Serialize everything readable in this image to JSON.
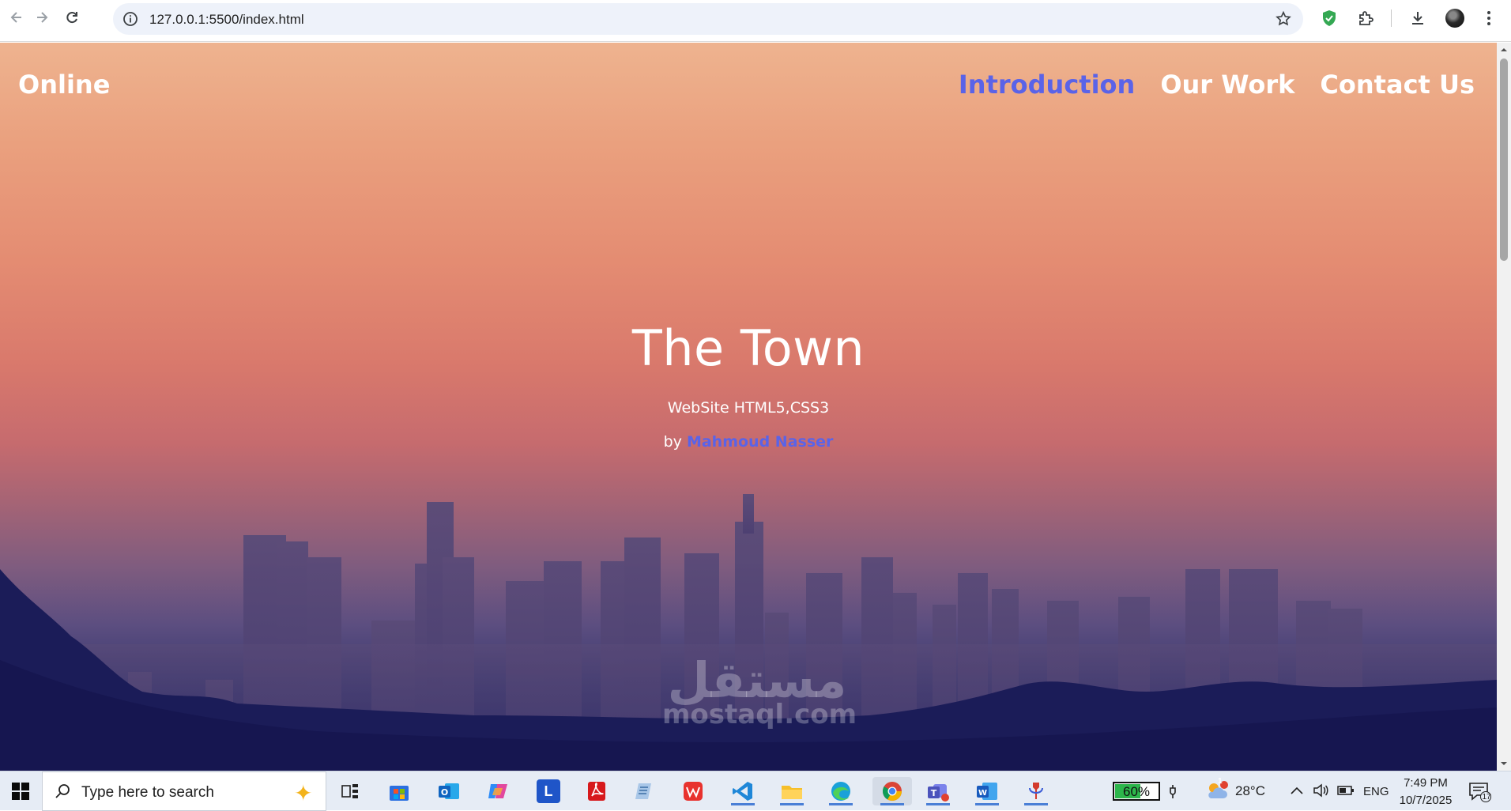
{
  "browser": {
    "url": "127.0.0.1:5500/index.html"
  },
  "site": {
    "logo": "Online",
    "menu": [
      {
        "label": "Introduction",
        "active": true
      },
      {
        "label": "Our Work",
        "active": false
      },
      {
        "label": "Contact Us",
        "active": false
      }
    ],
    "hero": {
      "title": "The Town",
      "subtitle": "WebSite HTML5,CSS3",
      "by_prefix": "by",
      "author": "Mahmoud Nasser"
    },
    "watermark": {
      "arabic": "مستقل",
      "latin": "mostaql.com"
    },
    "accent_color": "#5a63e8"
  },
  "taskbar": {
    "search_placeholder": "Type here to search",
    "battery": "60%",
    "battery_level": 0.6,
    "weather_temp": "28°C",
    "weather_badge": "1",
    "language": "ENG",
    "time": "7:49 PM",
    "date": "10/7/2025",
    "notification_count": "17",
    "apps": [
      "task-view",
      "microsoft-store",
      "outlook",
      "copilot",
      "l-app",
      "acrobat",
      "notepad",
      "wps",
      "vscode",
      "file-explorer",
      "edge",
      "chrome",
      "teams",
      "word",
      "tool"
    ]
  }
}
